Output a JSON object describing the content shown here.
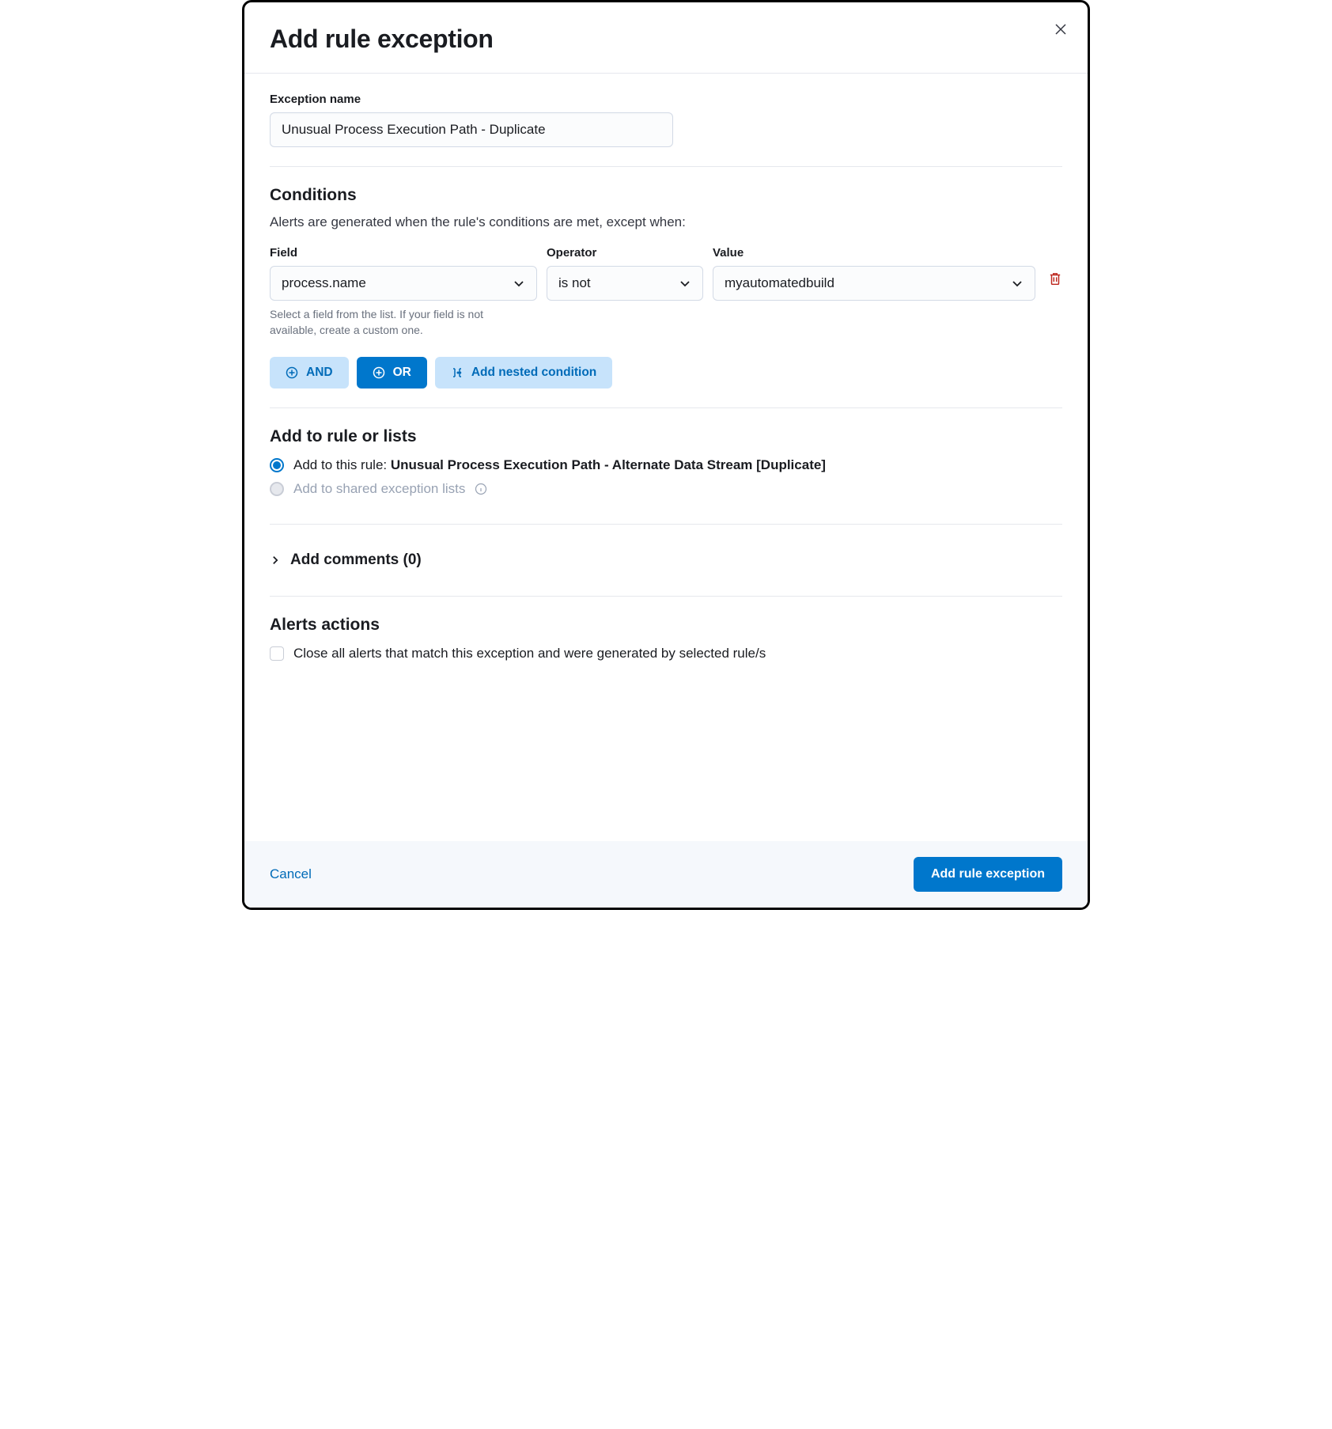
{
  "modal": {
    "title": "Add rule exception"
  },
  "exceptionName": {
    "label": "Exception name",
    "value": "Unusual Process Execution Path - Duplicate"
  },
  "conditions": {
    "title": "Conditions",
    "subtitle": "Alerts are generated when the rule's conditions are met, except when:",
    "columns": {
      "field": "Field",
      "operator": "Operator",
      "value": "Value"
    },
    "row": {
      "field": "process.name",
      "operator": "is not",
      "value": "myautomatedbuild"
    },
    "helper": "Select a field from the list. If your field is not available, create a custom one.",
    "buttons": {
      "and": "AND",
      "or": "OR",
      "nested": "Add nested condition"
    }
  },
  "addTo": {
    "title": "Add to rule or lists",
    "option1_prefix": "Add to this rule: ",
    "option1_rule": "Unusual Process Execution Path - Alternate Data Stream [Duplicate]",
    "option2": "Add to shared exception lists"
  },
  "comments": {
    "label": "Add comments (0)"
  },
  "alertsActions": {
    "title": "Alerts actions",
    "checkbox": "Close all alerts that match this exception and were generated by selected rule/s"
  },
  "footer": {
    "cancel": "Cancel",
    "submit": "Add rule exception"
  }
}
